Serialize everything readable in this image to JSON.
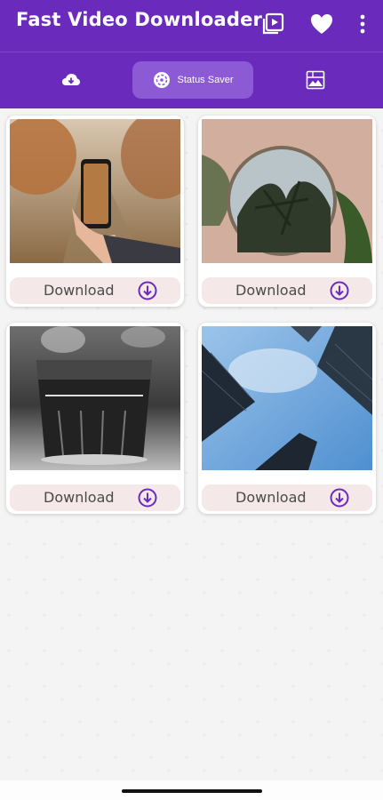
{
  "app": {
    "title": "Fast Video Downloader",
    "brand_color": "#6a2bbd"
  },
  "header_icons": [
    "playlist-icon",
    "heart-icon",
    "more-vert-icon"
  ],
  "tabs": [
    {
      "icon": "cloud-download-icon",
      "label": "",
      "active": false
    },
    {
      "icon": "status-saver-icon",
      "label": "Status Saver",
      "active": true
    },
    {
      "icon": "gallery-icon",
      "label": "",
      "active": false
    }
  ],
  "cards": [
    {
      "image": "autumn-path-phone",
      "download_label": "Download"
    },
    {
      "image": "palm-round-mirror",
      "download_label": "Download"
    },
    {
      "image": "black-white-glass",
      "download_label": "Download"
    },
    {
      "image": "skyscrapers-blue-sky",
      "download_label": "Download"
    }
  ]
}
